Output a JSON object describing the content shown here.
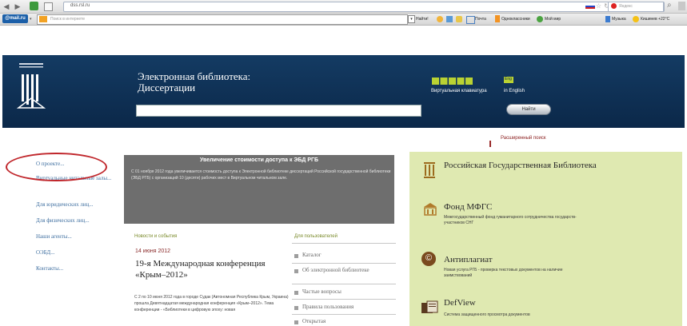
{
  "browser": {
    "address": "dss.rsl.ru",
    "search_placeholder": "Яндекс",
    "mailru_label": "@mail.ru",
    "toolbar_search_placeholder": "Поиск в интернете",
    "toolbar_links": [
      "Найти!",
      "Почта",
      "Одноклассники",
      "Мой мир",
      "Музыка",
      "Кишинев +22°C"
    ]
  },
  "header": {
    "title_line1": "Электронная библиотека:",
    "title_line2": "Диссертации",
    "keyboard_label": "Виртуальная клавиатура",
    "english_label": "in English",
    "find_button": "Найти",
    "advanced_search": "Расширенный поиск",
    "eng_badge": "Eng",
    "search_value": ""
  },
  "left_nav": [
    "О проекте...",
    "Виртуальные читальные залы...",
    "Для юридических лиц...",
    "Для физических лиц...",
    "Наши агенты...",
    "ОЭБД...",
    "Контакты..."
  ],
  "announcement": {
    "title": "Увеличение стоимости доступа к ЭБД РГБ",
    "body": "С 01 ноября 2012 года увеличивается стоимость доступа к Электронной библиотеке диссертаций Российской государственной библиотеки (ЭБД РГБ) с организаций 10 (десяти) рабочих мест в Виртуальном читальном зале."
  },
  "news": {
    "heading": "Новости и события",
    "date": "14 июня 2012",
    "title": "19-я Международная конференция «Крым–2012»",
    "body": "С 2 по 10 июня 2012 года в городе Судак (Автономная Республика Крым, Украина) прошла Девятнадцатая международная конференция «Крым–2012». Тема конференции - «Библиотеки в цифровую эпоху: новая"
  },
  "users": {
    "heading": "Для пользователей",
    "items": [
      "Каталог",
      "Об электронной библиотеке",
      "Частые вопросы",
      "Правила пользования",
      "Открытая"
    ]
  },
  "right_panel": {
    "items": [
      {
        "title": "Российская Государственная Библиотека",
        "subtitle": ""
      },
      {
        "title": "Фонд МФГС",
        "subtitle": "Межгосударственный фонд гуманитарного сотрудничества государств-участников СНГ"
      },
      {
        "title": "Антиплагиат",
        "subtitle": "Новая услуга РГБ - проверка текстовых документов на наличие заимствований"
      },
      {
        "title": "DefView",
        "subtitle": "Система защищенного просмотра документов"
      }
    ]
  },
  "colors": {
    "header_bg": "#0b2849",
    "announce_bg": "#6e6e6e",
    "right_panel_bg": "#dfe9b1",
    "highlight_oval": "#c0262b",
    "nav_link": "#3f6fa0"
  }
}
